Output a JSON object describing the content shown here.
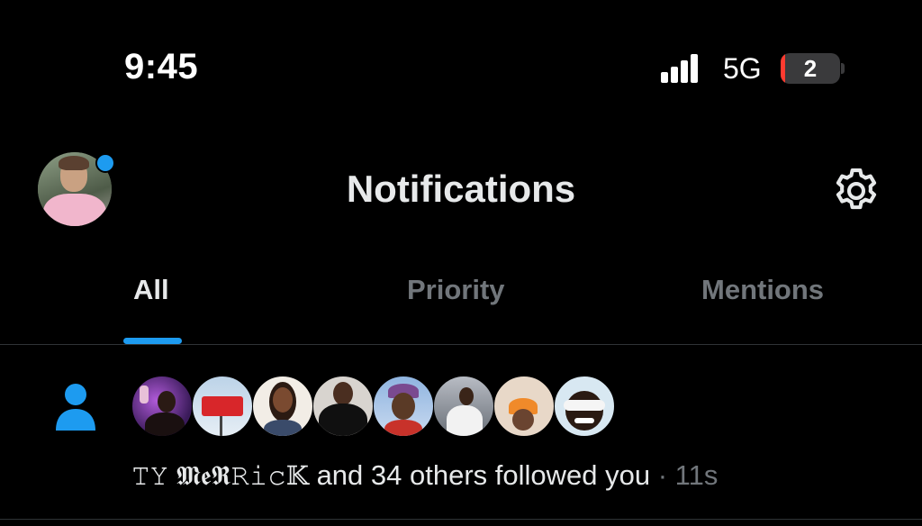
{
  "status_bar": {
    "time": "9:45",
    "network": "5G",
    "battery": "2",
    "battery_low_color": "#ff3b30"
  },
  "header": {
    "title": "Notifications",
    "avatar_icon": "profile-avatar",
    "settings_icon": "gear-icon",
    "unread_dot_color": "#1d9bf0"
  },
  "tabs": [
    {
      "label": "All",
      "active": true
    },
    {
      "label": "Priority",
      "active": false
    },
    {
      "label": "Mentions",
      "active": false
    }
  ],
  "notification": {
    "icon": "person-icon",
    "user_name": "𝚃𝚈 𝕸𝖊𝕽𝚁𝚒𝚌𝕂",
    "message": " and 34 others followed you",
    "separator": " · ",
    "time_ago": "11s",
    "follower_avatar_count": 8
  },
  "colors": {
    "accent": "#1d9bf0",
    "text_primary": "#e7e9ea",
    "text_secondary": "#71767b",
    "background": "#000000"
  }
}
